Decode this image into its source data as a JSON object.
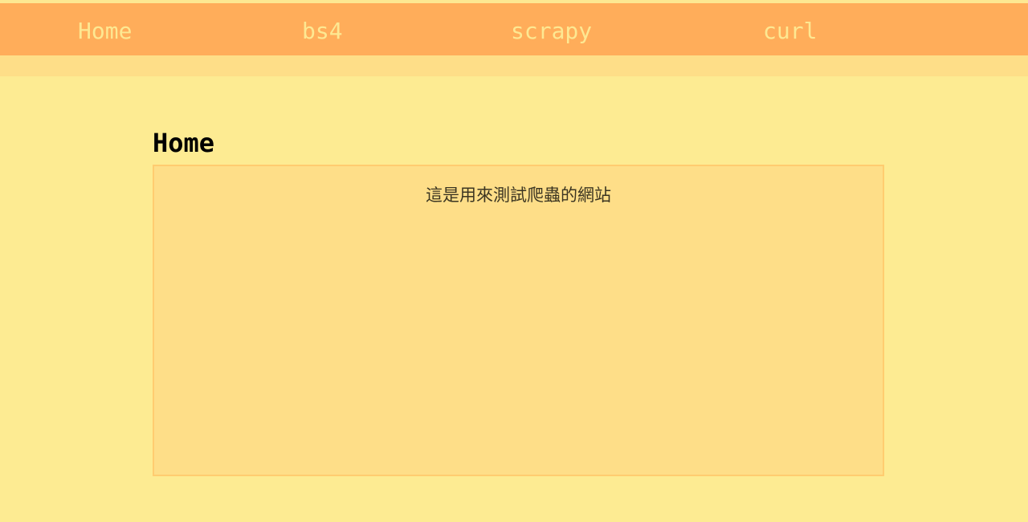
{
  "nav": {
    "items": [
      {
        "label": "Home"
      },
      {
        "label": "bs4"
      },
      {
        "label": "scrapy"
      },
      {
        "label": "curl"
      }
    ]
  },
  "main": {
    "title": "Home",
    "content": "這是用來測試爬蟲的網站"
  },
  "colors": {
    "background": "#fdeb92",
    "navbar": "#ffad5a",
    "nav_text": "#fde892",
    "content_box": "#fede88",
    "content_border": "#ffcc70"
  }
}
